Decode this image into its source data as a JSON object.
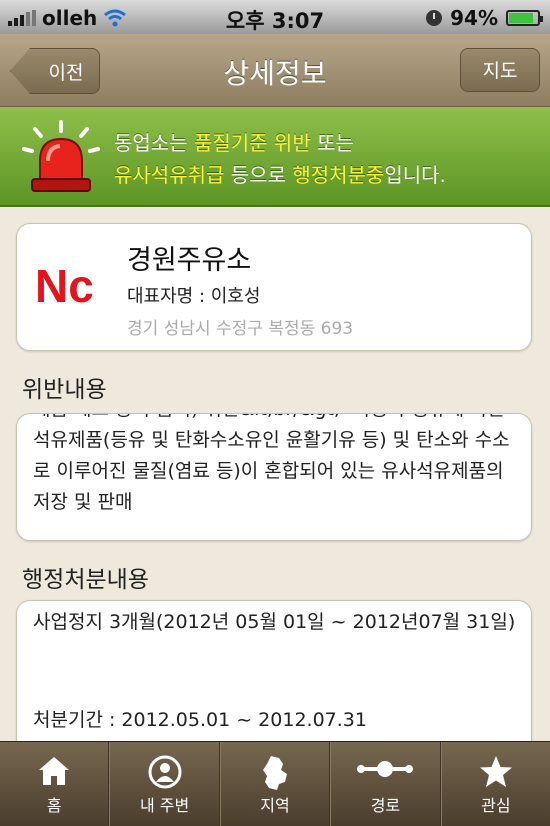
{
  "status_bar": {
    "carrier": "olleh",
    "time": "오후 3:07",
    "battery": "94%",
    "battery_level": 0.94
  },
  "nav": {
    "title": "상세정보",
    "back_label": "이전",
    "map_label": "지도"
  },
  "banner": {
    "line1_a": "동업소는 ",
    "line1_hl1": "품질기준 위반",
    "line1_b": " 또는",
    "line2_hl1": "유사석유취급",
    "line2_a": " 등으로 ",
    "line2_hl2": "행정처분중",
    "line2_b": "입니다."
  },
  "station": {
    "logo_text": "Nc",
    "name": "경원주유소",
    "representative": "대표자명 : 이호성",
    "address": "경기 성남시 수정구 복정동 693"
  },
  "violation": {
    "heading": "위반내용",
    "text": "제품 제조 등의 금지) 위반&lt;br/&gt;- 자동차 등유에 다른 석유제품(등유 및 탄화수소유인 윤활기유 등) 및 탄소와 수소로 이루어진 물질(염료 등)이 혼합되어 있는 유사석유제품의 저장 및 판매"
  },
  "action": {
    "heading": "행정처분내용",
    "text": "사업정지 3개월(2012년 05월 01일 ~ 2012년07월 31일)",
    "period": "처분기간 : 2012.05.01 ~ 2012.07.31"
  },
  "tabs": [
    {
      "label": "홈",
      "icon": "home-icon"
    },
    {
      "label": "내 주변",
      "icon": "person-icon"
    },
    {
      "label": "지역",
      "icon": "region-map-icon"
    },
    {
      "label": "경로",
      "icon": "route-icon"
    },
    {
      "label": "관심",
      "icon": "star-icon"
    }
  ],
  "colors": {
    "logo_red": "#e3141b",
    "banner_green": "#6fa331",
    "highlight": "#fff23a",
    "nav_brown": "#a3926f"
  }
}
